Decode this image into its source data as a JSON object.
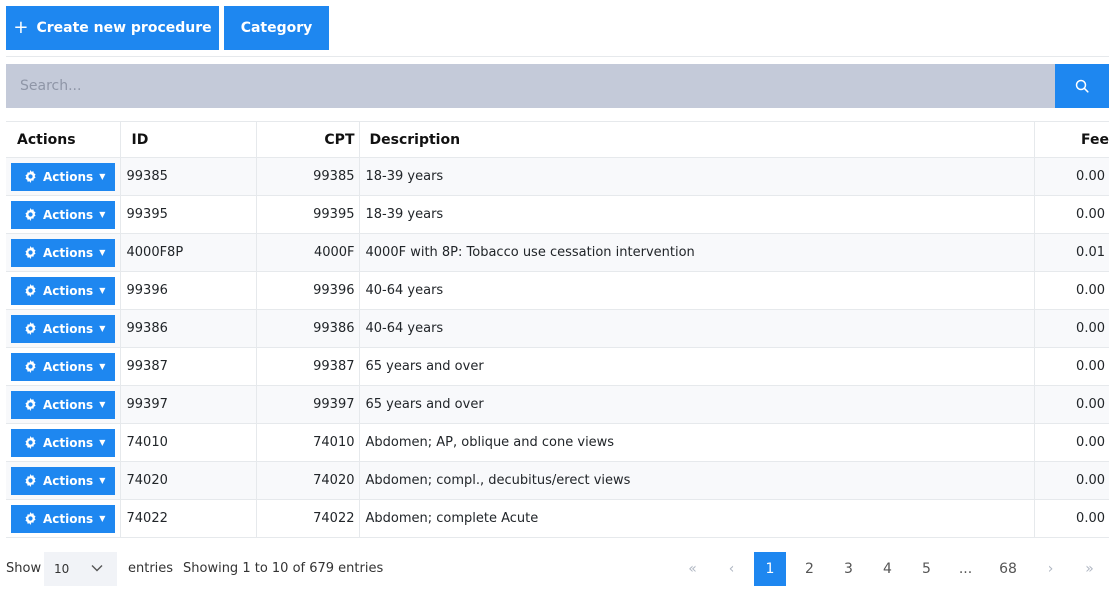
{
  "toolbar": {
    "create_label": "Create new procedure",
    "category_label": "Category"
  },
  "search": {
    "placeholder": "Search...",
    "button_icon": "search-icon"
  },
  "table": {
    "headers": {
      "actions": "Actions",
      "id": "ID",
      "cpt": "CPT",
      "description": "Description",
      "fee": "Fee"
    },
    "action_label": "Actions",
    "rows": [
      {
        "id": "99385",
        "cpt": "99385",
        "description": "18-39 years",
        "fee": "0.00"
      },
      {
        "id": "99395",
        "cpt": "99395",
        "description": "18-39 years",
        "fee": "0.00"
      },
      {
        "id": "4000F8P",
        "cpt": "4000F",
        "description": "4000F with 8P: Tobacco use cessation intervention",
        "fee": "0.01"
      },
      {
        "id": "99396",
        "cpt": "99396",
        "description": "40-64 years",
        "fee": "0.00"
      },
      {
        "id": "99386",
        "cpt": "99386",
        "description": "40-64 years",
        "fee": "0.00"
      },
      {
        "id": "99387",
        "cpt": "99387",
        "description": "65 years and over",
        "fee": "0.00"
      },
      {
        "id": "99397",
        "cpt": "99397",
        "description": "65 years and over",
        "fee": "0.00"
      },
      {
        "id": "74010",
        "cpt": "74010",
        "description": "Abdomen; AP, oblique and cone views",
        "fee": "0.00"
      },
      {
        "id": "74020",
        "cpt": "74020",
        "description": "Abdomen; compl., decubitus/erect views",
        "fee": "0.00"
      },
      {
        "id": "74022",
        "cpt": "74022",
        "description": "Abdomen; complete Acute",
        "fee": "0.00"
      }
    ]
  },
  "footer": {
    "show_label": "Show",
    "page_size": "10",
    "entries_label": "entries",
    "showing_text": "Showing 1 to 10 of 679 entries"
  },
  "pagination": {
    "first": "«",
    "prev": "‹",
    "pages": [
      "1",
      "2",
      "3",
      "4",
      "5"
    ],
    "ellipsis": "...",
    "last_page": "68",
    "next": "›",
    "last": "»",
    "active_page": "1"
  },
  "colors": {
    "primary": "#1e87f0",
    "search_bg": "#c4cad9"
  }
}
